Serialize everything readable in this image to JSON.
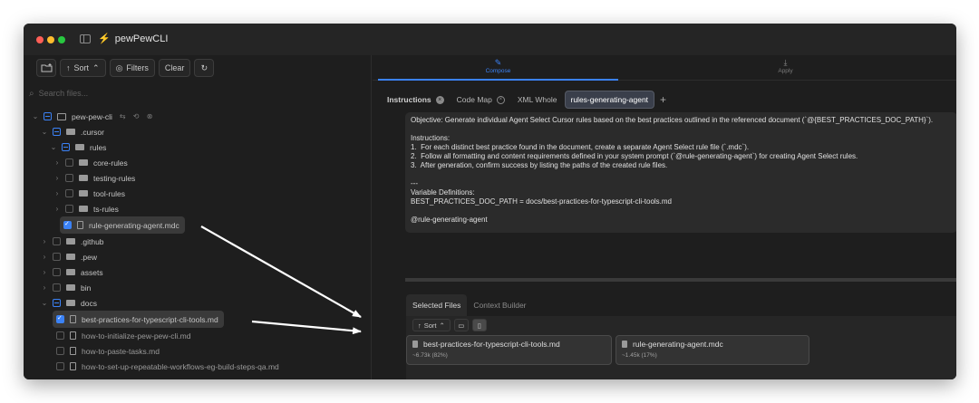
{
  "window": {
    "title": "pewPewCLI"
  },
  "toolbar": {
    "sort_label": "Sort",
    "filters_label": "Filters",
    "clear_label": "Clear"
  },
  "search": {
    "placeholder": "Search files..."
  },
  "tree": {
    "root": "pew-pew-cli",
    "items": {
      "cursor": ".cursor",
      "rules": "rules",
      "core_rules": "core-rules",
      "testing_rules": "testing-rules",
      "tool_rules": "tool-rules",
      "ts_rules": "ts-rules",
      "rule_agent": "rule-generating-agent.mdc",
      "github": ".github",
      "pew": ".pew",
      "assets": "assets",
      "bin": "bin",
      "docs": "docs",
      "doc_best": "best-practices-for-typescript-cli-tools.md",
      "doc_init": "how-to-initialize-pew-pew-cli.md",
      "doc_paste": "how-to-paste-tasks.md",
      "doc_setup": "how-to-set-up-repeatable-workflows-eg-build-steps-qa.md"
    }
  },
  "modes": {
    "compose": "Compose",
    "apply": "Apply"
  },
  "prompt_tabs": {
    "instructions": "Instructions",
    "code_map": "Code Map",
    "xml_whole": "XML Whole",
    "rules_agent": "rules-generating-agent"
  },
  "editor": {
    "lines": [
      "Objective: Generate individual Agent Select Cursor rules based on the best practices outlined in the referenced document (`@{BEST_PRACTICES_DOC_PATH}`).",
      "",
      "Instructions:",
      "1.  For each distinct best practice found in the document, create a separate Agent Select rule file (`.mdc`).",
      "2.  Follow all formatting and content requirements defined in your system prompt (`@rule-generating-agent`) for creating Agent Select rules.",
      "3.  After generation, confirm success by listing the paths of the created rule files.",
      "",
      "---",
      "Variable Definitions:",
      "BEST_PRACTICES_DOC_PATH = docs/best-practices-for-typescript-cli-tools.md",
      "",
      "@rule-generating-agent"
    ]
  },
  "selection": {
    "tab_selected": "Selected Files",
    "tab_context": "Context Builder",
    "sort_label": "Sort",
    "files": [
      {
        "name": "best-practices-for-typescript-cli-tools.md",
        "meta": "~6.73k (82%)"
      },
      {
        "name": "rule-generating-agent.mdc",
        "meta": "~1.45k (17%)"
      }
    ]
  },
  "colors": {
    "accent": "#3b82f6",
    "bolt": "#f2c744"
  }
}
